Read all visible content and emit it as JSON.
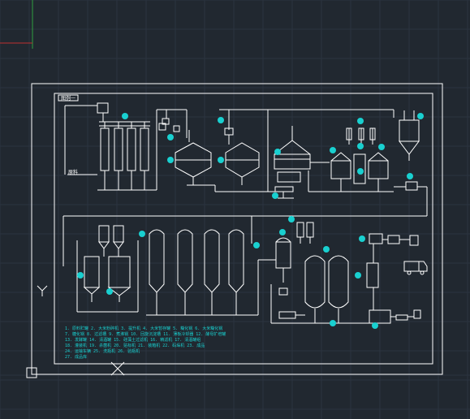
{
  "drawing": {
    "title_block": "图例一",
    "feed_label": "原料",
    "colors": {
      "background": "#212830",
      "grid": "#2c3440",
      "lines": "#ffffff",
      "tags": "#19d0d0",
      "axis_x": "#c03030",
      "axis_y": "#30a040"
    },
    "legend": [
      "1. 原料贮罐  2. 大米粉碎机  3. 提升机  4. 大米暂存罐  5. 糊化锅  6. 大米糊化锅",
      "7. 糖化锅  8. 过滤槽  9. 煮沸锅  10. 回旋沉淀槽  11. 薄板冷却器  12. 酵母扩培罐",
      "13. 发酵罐  14. 清酒罐  15. 硅藻土过滤机  16. 精滤机  17. 清酒罐组",
      "18. 灌装机  19. 杀菌机  20. 贴标机  21. 装箱机  22. 码垛机  23. 成品",
      "24. 运输车辆  25. 洗瓶机  26. 验瓶机",
      "27. 成品库"
    ]
  }
}
